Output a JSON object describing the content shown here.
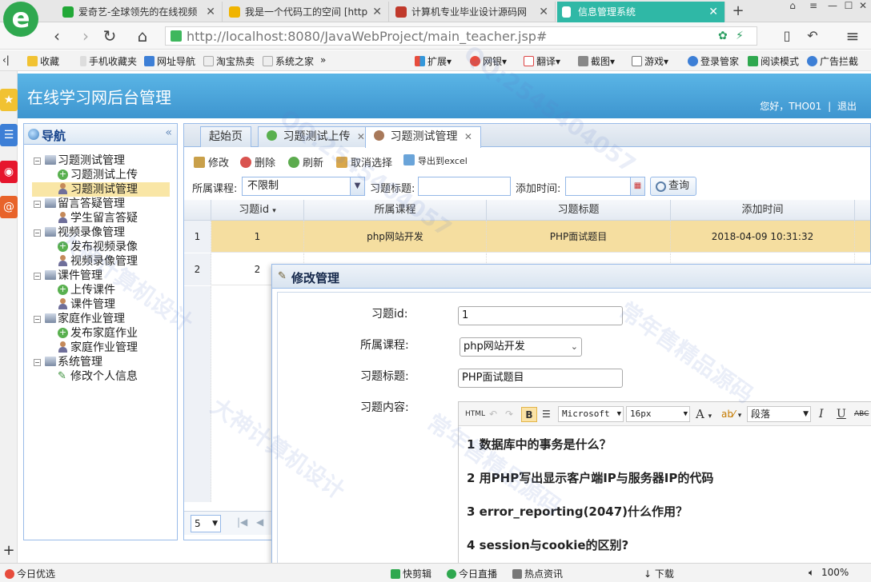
{
  "browser": {
    "tabs": [
      {
        "title": "爱奇艺-全球领先的在线视频",
        "color": "#22a837"
      },
      {
        "title": "我是一个代码工的空间 [http",
        "color": "#f0b400"
      },
      {
        "title": "计算机专业毕业设计源码网",
        "color": "#c0392b"
      },
      {
        "title": "信息管理系统",
        "color": "#ffffff"
      }
    ],
    "url": "http://localhost:8080/JavaWebProject/main_teacher.jsp#",
    "bookmarks": [
      "收藏",
      "手机收藏夹",
      "网址导航",
      "淘宝热卖",
      "系统之家",
      "扩展",
      "网银",
      "翻译",
      "截图",
      "游戏",
      "登录管家",
      "阅读模式",
      "广告拦截"
    ]
  },
  "app": {
    "title": "在线学习网后台管理",
    "greeting": "您好，THO01",
    "separator": "|",
    "logout": "退出"
  },
  "nav": {
    "title": "导航",
    "groups": [
      {
        "label": "习题测试管理",
        "items": [
          {
            "label": "习题测试上传",
            "icon": "add"
          },
          {
            "label": "习题测试管理",
            "icon": "user",
            "selected": true
          }
        ]
      },
      {
        "label": "留言答疑管理",
        "items": [
          {
            "label": "学生留言答疑",
            "icon": "user"
          }
        ]
      },
      {
        "label": "视频录像管理",
        "items": [
          {
            "label": "发布视频录像",
            "icon": "add"
          },
          {
            "label": "视频录像管理",
            "icon": "user"
          }
        ]
      },
      {
        "label": "课件管理",
        "items": [
          {
            "label": "上传课件",
            "icon": "add"
          },
          {
            "label": "课件管理",
            "icon": "user"
          }
        ]
      },
      {
        "label": "家庭作业管理",
        "items": [
          {
            "label": "发布家庭作业",
            "icon": "add"
          },
          {
            "label": "家庭作业管理",
            "icon": "user"
          }
        ]
      },
      {
        "label": "系统管理",
        "items": [
          {
            "label": "修改个人信息",
            "icon": "pencil"
          }
        ]
      }
    ]
  },
  "tabs": [
    {
      "label": "起始页"
    },
    {
      "label": "习题测试上传",
      "closable": true
    },
    {
      "label": "习题测试管理",
      "closable": true,
      "active": true
    }
  ],
  "toolbar": {
    "edit": "修改",
    "delete": "删除",
    "refresh": "刷新",
    "unselect": "取消选择",
    "export": "导出到excel"
  },
  "filters": {
    "course_label": "所属课程:",
    "course_value": "不限制",
    "title_label": "习题标题:",
    "time_label": "添加时间:",
    "query": "查询"
  },
  "grid": {
    "columns": [
      "习题id",
      "所属课程",
      "习题标题",
      "添加时间"
    ],
    "rows": [
      {
        "num": "1",
        "id": "1",
        "course": "php网站开发",
        "title": "PHP面试题目",
        "time": "2018-04-09 10:31:32",
        "selected": true
      },
      {
        "num": "2",
        "id": "2",
        "course": "",
        "title": "",
        "time": ""
      }
    ],
    "page_size": "5"
  },
  "modal": {
    "title": "修改管理",
    "id_label": "习题id:",
    "id_value": "1",
    "course_label": "所属课程:",
    "course_value": "php网站开发",
    "title_label": "习题标题:",
    "title_value": "PHP面试题目",
    "content_label": "习题内容:",
    "editor": {
      "html": "HTML",
      "bold": "B",
      "font": "Microsoft",
      "size": "16px",
      "color": "A",
      "paragraph": "段落",
      "italic": "I",
      "underline": "U",
      "strike": "ABC"
    },
    "questions": [
      "1 数据库中的事务是什么？",
      "2 用PHP写出显示客户端IP与服务器IP的代码",
      "3 error_reporting(2047)什么作用？",
      "4 session与cookie的区别?"
    ]
  },
  "statusbar": {
    "left": "今日优选",
    "items": [
      "快剪辑",
      "今日直播",
      "热点资讯",
      "下载"
    ],
    "zoom": "100%"
  },
  "watermarks": [
    "大神计算机设计",
    "QQ:2545404057",
    "常年售精品源码"
  ]
}
